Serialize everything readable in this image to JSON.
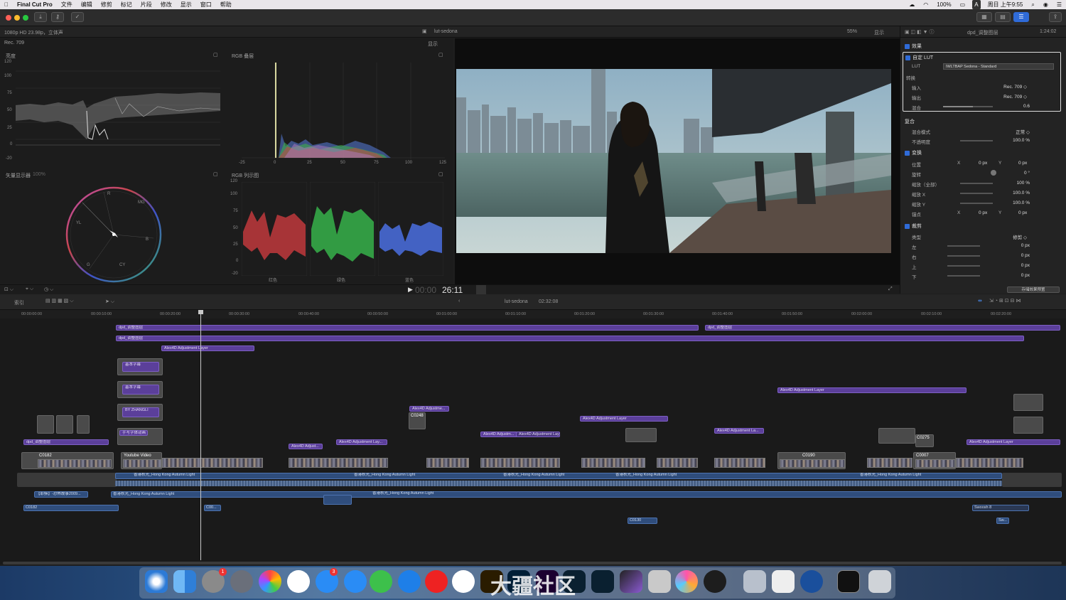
{
  "menubar": {
    "apple": "",
    "app_name": "Final Cut Pro",
    "menus": [
      "文件",
      "编辑",
      "修剪",
      "标记",
      "片段",
      "修改",
      "显示",
      "窗口",
      "帮助"
    ],
    "battery": "100%",
    "input_method": "A",
    "clock": "周日 上午9:55"
  },
  "viewer_header": {
    "format": "1080p HD 23.98p，立体声",
    "project_name": "lut-sedona",
    "zoom": "55%",
    "display_menu": "显示"
  },
  "scopes": {
    "rec_label": "Rec. 709",
    "display_menu": "显示",
    "luma_title": "亮度",
    "luma_ticks": [
      "120",
      "100",
      "75",
      "50",
      "25",
      "0",
      "-20"
    ],
    "rgb_parade_overlay_title": "RGB 叠层",
    "histogram_ticks": [
      "-25",
      "0",
      "25",
      "50",
      "75",
      "100",
      "125"
    ],
    "vectorscope_title": "矢量显示器",
    "vectorscope_zoom": "100%",
    "vectorscope_labels": [
      "R",
      "MG",
      "B",
      "CY",
      "G",
      "YL"
    ],
    "rgb_parade_title": "RGB 列示图",
    "parade_ticks": [
      "120",
      "100",
      "75",
      "50",
      "25",
      "0",
      "-20"
    ],
    "parade_channels": [
      "红色",
      "绿色",
      "蓝色"
    ]
  },
  "playback": {
    "timecode_dim": "00:00",
    "timecode": "26:11"
  },
  "inspector": {
    "clip_name": "dpd_调整图层",
    "duration": "1:24:02",
    "effects_header": "效果",
    "custom_lut": "自定 LUT",
    "lut_label": "LUT",
    "lut_value": "IWLTBAP Sedona - Standard",
    "convert_label": "转换",
    "input_label": "输入",
    "input_value": "Rec. 709 ◇",
    "output_label": "输出",
    "output_value": "Rec. 709 ◇",
    "mix_label": "混合",
    "mix_value": "0.6",
    "composite_header": "复合",
    "blend_label": "混合模式",
    "blend_value": "正常 ◇",
    "opacity_label": "不透明度",
    "opacity_value": "100.0 %",
    "transform_header": "变换",
    "position_label": "位置",
    "position_x": "0 px",
    "position_y": "0 px",
    "x": "X",
    "y": "Y",
    "rotation_label": "旋转",
    "rotation_value": "0 °",
    "scale_all_label": "缩放（全部）",
    "scale_all_value": "100 %",
    "scale_x_label": "缩放 X",
    "scale_x_value": "100.0 %",
    "scale_y_label": "缩放 Y",
    "scale_y_value": "100.0 %",
    "anchor_label": "锚点",
    "anchor_x": "0 px",
    "anchor_y": "0 px",
    "crop_header": "裁剪",
    "type_label": "类型",
    "type_value": "修剪 ◇",
    "left_label": "左",
    "left_value": "0 px",
    "right_label": "右",
    "right_value": "0 px",
    "top_label": "上",
    "top_value": "0 px",
    "bottom_label": "下",
    "bottom_value": "0 px",
    "save_preset": "存储效果预置"
  },
  "timeline": {
    "index_label": "索引",
    "project_name": "lut-sedona",
    "project_duration": "02:32:08",
    "ruler": [
      "00:00:00:00",
      "00:00:10:00",
      "00:00:20:00",
      "00:00:30:00",
      "00:00:40:00",
      "00:00:50:00",
      "00:01:00:00",
      "00:01:10:00",
      "00:01:20:00",
      "00:01:30:00",
      "00:01:40:00",
      "00:01:50:00",
      "00:02:00:00",
      "00:02:10:00",
      "00:02:20:00"
    ],
    "adj_top_1": "dpd_调整图层",
    "adj_top_2": "dpd_调整图层",
    "adj_2": "dpd_调整图层",
    "alex_1": "Alex4D Adjustment Layer",
    "title_1": "基本字幕",
    "title_2": "基本字幕",
    "title_3": "BY ZHANGLI",
    "title_4": "手写字体动画",
    "adj_3": "dpd_调整图层",
    "alex_2": "Alex4D Adjustment Layer",
    "alex_3": "Alex4D Adjustment Layer",
    "alex_4": "Alex4D Adjustme...",
    "alex_5": "Alex4D Adjust...",
    "alex_6": "Alex4D Adjustment Lay...",
    "alex_7": "Alex4D Adjustm...",
    "alex_8": "Alex4D Adjustment Layer",
    "alex_9": "Alex4D Adjustment La...",
    "alex_10": "Alex4D Adjustment Layer",
    "clip_c0182": "C0182",
    "clip_youtube": "Youtube Video",
    "clip_c0130": "C0130",
    "clip_c0190": "C0190",
    "clip_c0248": "C0248",
    "clip_c0275": "C0275",
    "clip_c0007": "C0007",
    "audio_main_1": "香港秋光_Hong Kong Autumn Light",
    "audio_main_2": "香港秋光_Hong Kong Autumn Light",
    "audio_main_3": "香港秋光_Hong Kong Autumn Light",
    "audio_main_4": "香港秋光_Hong Kong Autumn Light",
    "audio_main_5": "香港秋光_Hong Kong Autumn Light",
    "audio_sub_1": "【耶稣】-恐怖故事2009...",
    "audio_sub_2": "香港秋光_Hong Kong Autumn Light",
    "audio_sub_3": "香港秋光_Hong Kong Autumn Light",
    "audio_c0182": "C0182",
    "audio_c00": "C00...",
    "audio_c0130": "C0130",
    "audio_swoosh": "Swoosh 8",
    "audio_sw": "Sw..."
  },
  "dock": {
    "notification_badge_1": "1",
    "notification_badge_2": "3",
    "watermark": "大疆社区"
  }
}
